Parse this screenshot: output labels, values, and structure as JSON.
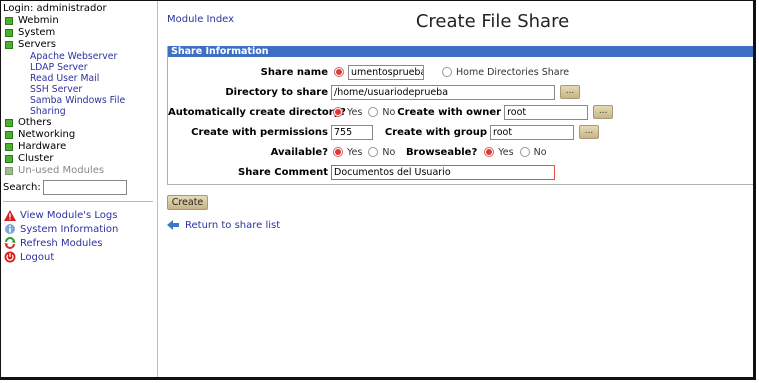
{
  "sidebar": {
    "login_text": "Login: administrador",
    "categories": [
      {
        "label": "Webmin"
      },
      {
        "label": "System"
      },
      {
        "label": "Servers"
      }
    ],
    "server_items": [
      {
        "label": "Apache Webserver"
      },
      {
        "label": "LDAP Server"
      },
      {
        "label": "Read User Mail"
      },
      {
        "label": "SSH Server"
      },
      {
        "label": "Samba Windows File Sharing"
      }
    ],
    "more_categories": [
      {
        "label": "Others"
      },
      {
        "label": "Networking"
      },
      {
        "label": "Hardware"
      },
      {
        "label": "Cluster"
      },
      {
        "label": "Un-used Modules"
      }
    ],
    "search_label": "Search:",
    "search_value": "",
    "links": [
      {
        "label": "View Module's Logs",
        "icon": "warning-icon"
      },
      {
        "label": "System Information",
        "icon": "info-icon"
      },
      {
        "label": "Refresh Modules",
        "icon": "refresh-icon"
      },
      {
        "label": "Logout",
        "icon": "logout-icon"
      }
    ]
  },
  "main": {
    "module_index": "Module Index",
    "title": "Create File Share",
    "section_title": "Share Information",
    "share_name_label": "Share name",
    "share_name_value": "umentosprueba",
    "home_dirs_label": "Home Directories Share",
    "directory_label": "Directory to share",
    "directory_value": "/home/usuariodeprueba",
    "auto_create_label": "Automatically create directory?",
    "yes": "Yes",
    "no": "No",
    "owner_label": "Create with owner",
    "owner_value": "root",
    "permissions_label": "Create with permissions",
    "permissions_value": "755",
    "group_label": "Create with group",
    "group_value": "root",
    "available_label": "Available?",
    "browseable_label": "Browseable?",
    "comment_label": "Share Comment",
    "comment_value": "Documentos del Usuario",
    "dots_label": "...",
    "create_button": "Create",
    "return_link": "Return to share list"
  },
  "colors": {
    "section_header": "#3d6fc5",
    "link": "#2b33a0",
    "radio_selected": "#e2372e",
    "category_square": "#4caf2f"
  }
}
